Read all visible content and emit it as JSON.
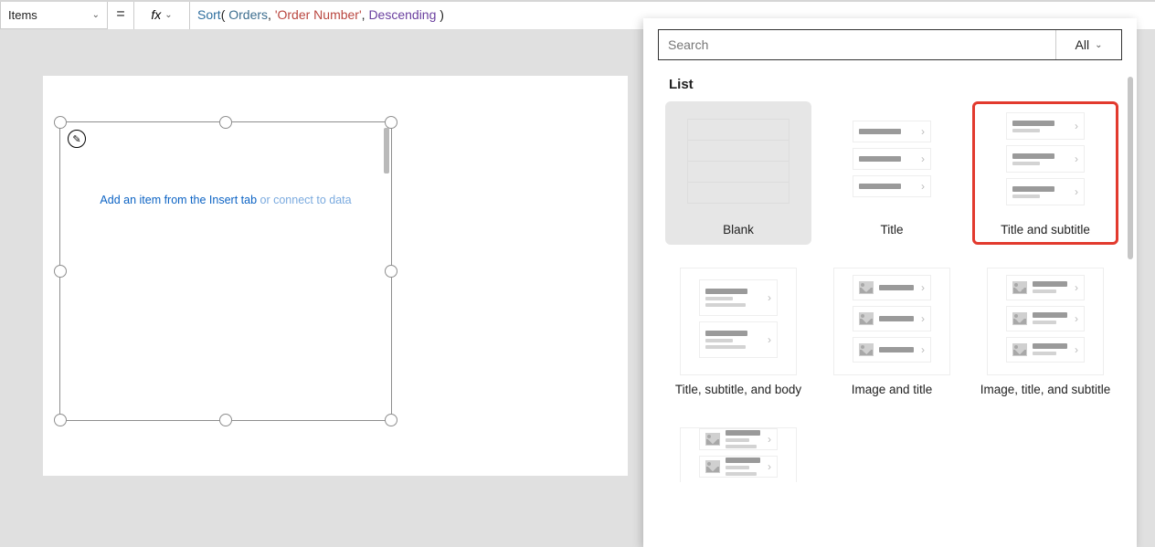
{
  "formula_bar": {
    "property": "Items",
    "equals": "=",
    "fx": "fx",
    "tokens": {
      "sort": "Sort",
      "p1": "( ",
      "orders": "Orders",
      "c1": ", ",
      "ordnum": "'Order Number'",
      "c2": ", ",
      "desc": "Descending",
      "p2": " )"
    }
  },
  "canvas": {
    "placeholder_a": "Add an item from the Insert tab ",
    "placeholder_b": "or connect to data"
  },
  "panel": {
    "search_placeholder": "Search",
    "filter_label": "All",
    "section": "List",
    "cards": [
      {
        "label": "Blank"
      },
      {
        "label": "Title"
      },
      {
        "label": "Title and subtitle"
      },
      {
        "label": "Title, subtitle, and body"
      },
      {
        "label": "Image and title"
      },
      {
        "label": "Image, title, and subtitle"
      }
    ]
  }
}
